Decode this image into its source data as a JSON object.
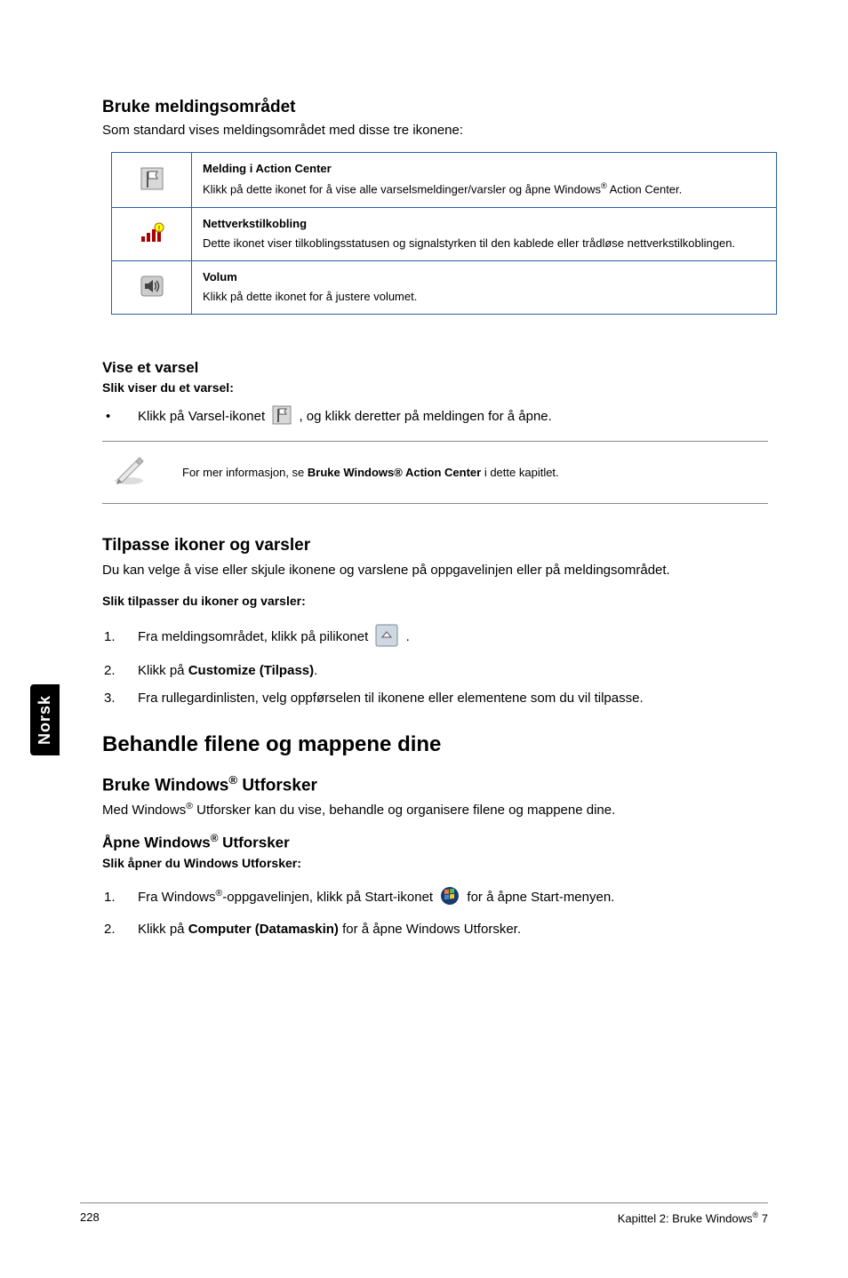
{
  "side_tab": "Norsk",
  "section1": {
    "title": "Bruke meldingsområdet",
    "intro": "Som standard vises meldingsområdet med disse tre ikonene:",
    "rows": [
      {
        "title": "Melding i Action Center",
        "desc_pre": "Klikk på dette ikonet for å vise alle varselsmeldinger/varsler og åpne Windows",
        "desc_post": " Action Center."
      },
      {
        "title": "Nettverkstilkobling",
        "desc": "Dette ikonet viser tilkoblingsstatusen og signalstyrken til den kablede eller trådløse nettverkstilkoblingen."
      },
      {
        "title": "Volum",
        "desc": "Klikk på dette ikonet for å justere volumet."
      }
    ]
  },
  "section2": {
    "title": "Vise et varsel",
    "bold": "Slik viser du et varsel:",
    "bullet_pre": "Klikk på Varsel-ikonet ",
    "bullet_post": ", og klikk deretter på meldingen for å åpne.",
    "note_pre": "For mer informasjon, se ",
    "note_bold": "Bruke Windows® Action Center",
    "note_post": " i dette kapitlet."
  },
  "section3": {
    "title": "Tilpasse ikoner og varsler",
    "intro": "Du kan velge å vise eller skjule ikonene og varslene på oppgavelinjen eller på meldingsområdet.",
    "bold": "Slik tilpasser du ikoner og varsler:",
    "step1_pre": "Fra meldingsområdet, klikk på pilikonet ",
    "step1_post": ".",
    "step2_pre": "Klikk på ",
    "step2_bold": "Customize (Tilpass)",
    "step2_post": ".",
    "step3": "Fra rullegardinlisten, velg oppførselen til ikonene eller elementene som du vil tilpasse."
  },
  "main_heading": "Behandle filene og mappene dine",
  "section4": {
    "title_pre": "Bruke Windows",
    "title_post": " Utforsker",
    "intro_pre": "Med Windows",
    "intro_post": " Utforsker kan du vise, behandle og organisere filene og mappene dine."
  },
  "section5": {
    "title_pre": "Åpne Windows",
    "title_post": " Utforsker",
    "bold": "Slik åpner du Windows Utforsker:",
    "step1_pre": "Fra Windows",
    "step1_mid": "-oppgavelinjen, klikk på Start-ikonet ",
    "step1_post": " for å åpne Start-menyen.",
    "step2_pre": "Klikk på ",
    "step2_bold": "Computer (Datamaskin)",
    "step2_post": " for å åpne Windows Utforsker."
  },
  "footer": {
    "page": "228",
    "chapter_pre": "Kapittel 2: Bruke Windows",
    "chapter_post": " 7"
  }
}
